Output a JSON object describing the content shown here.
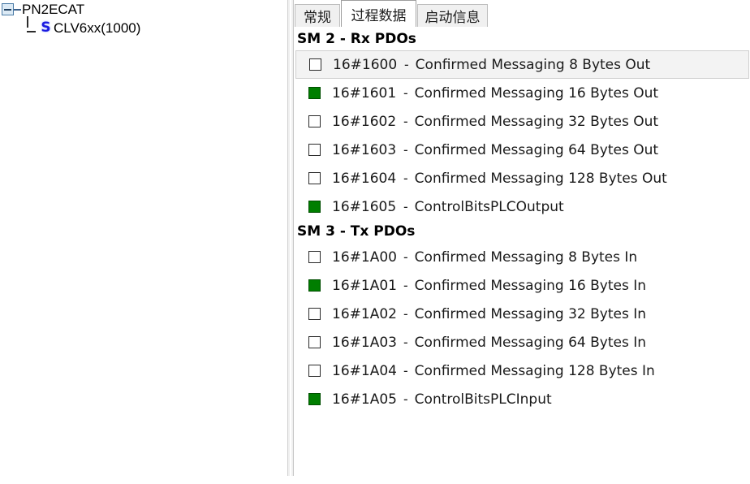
{
  "tree": {
    "items": [
      {
        "label": "PN2ECAT",
        "level": 0,
        "expander": "minus-box",
        "icon": null
      },
      {
        "label": "CLV6xx(1000)",
        "level": 1,
        "expander": null,
        "icon": "sick-s-icon"
      }
    ]
  },
  "tabs": [
    {
      "id": "tab-general",
      "label": "常规",
      "active": false
    },
    {
      "id": "tab-process",
      "label": "过程数据",
      "active": true
    },
    {
      "id": "tab-startup",
      "label": "启动信息",
      "active": false
    }
  ],
  "sections": [
    {
      "title": "SM 2 - Rx PDOs",
      "rows": [
        {
          "index": "16#1600",
          "dash": "-",
          "name": "Confirmed Messaging 8 Bytes Out",
          "checked": false,
          "selected": true
        },
        {
          "index": "16#1601",
          "dash": "-",
          "name": "Confirmed Messaging 16 Bytes Out",
          "checked": true,
          "selected": false
        },
        {
          "index": "16#1602",
          "dash": "-",
          "name": "Confirmed Messaging 32 Bytes Out",
          "checked": false,
          "selected": false
        },
        {
          "index": "16#1603",
          "dash": "-",
          "name": "Confirmed Messaging 64 Bytes Out",
          "checked": false,
          "selected": false
        },
        {
          "index": "16#1604",
          "dash": "-",
          "name": "Confirmed Messaging 128 Bytes Out",
          "checked": false,
          "selected": false
        },
        {
          "index": "16#1605",
          "dash": "-",
          "name": "ControlBitsPLCOutput",
          "checked": true,
          "selected": false
        }
      ]
    },
    {
      "title": "SM 3 - Tx PDOs",
      "rows": [
        {
          "index": "16#1A00",
          "dash": "-",
          "name": "Confirmed Messaging 8 Bytes In",
          "checked": false,
          "selected": false
        },
        {
          "index": "16#1A01",
          "dash": "-",
          "name": "Confirmed Messaging 16 Bytes In",
          "checked": true,
          "selected": false
        },
        {
          "index": "16#1A02",
          "dash": "-",
          "name": "Confirmed Messaging 32 Bytes In",
          "checked": false,
          "selected": false
        },
        {
          "index": "16#1A03",
          "dash": "-",
          "name": "Confirmed Messaging 64 Bytes In",
          "checked": false,
          "selected": false
        },
        {
          "index": "16#1A04",
          "dash": "-",
          "name": "Confirmed Messaging 128 Bytes In",
          "checked": false,
          "selected": false
        },
        {
          "index": "16#1A05",
          "dash": "-",
          "name": "ControlBitsPLCInput",
          "checked": true,
          "selected": false
        }
      ]
    }
  ],
  "icons": {
    "sick_s": "S"
  },
  "colors": {
    "checked_green": "#007e00",
    "selected_row_bg": "#f3f3f3",
    "tab_inactive_bg": "#f0f0f0",
    "tree_icon_blue": "#1a1ae0"
  }
}
